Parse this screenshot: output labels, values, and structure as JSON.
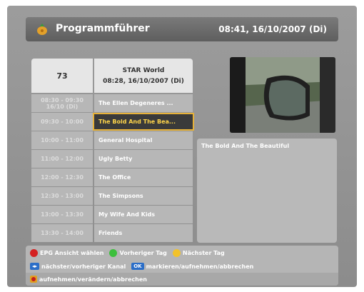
{
  "header": {
    "title": "Programmführer",
    "datetime": "08:41, 16/10/2007 (Di)"
  },
  "channel": {
    "number": "73",
    "name": "STAR World",
    "datetime": "08:28, 16/10/2007 (Di)"
  },
  "schedule": [
    {
      "time": "08:30 - 09:30 16/10 (Di)",
      "program": "The Ellen Degeneres ..."
    },
    {
      "time": "09:30 - 10:00",
      "program": "The Bold And The Bea..."
    },
    {
      "time": "10:00 - 11:00",
      "program": "General Hospital"
    },
    {
      "time": "11:00 - 12:00",
      "program": "Ugly Betty"
    },
    {
      "time": "12:00 - 12:30",
      "program": "The Office"
    },
    {
      "time": "12:30 - 13:00",
      "program": "The Simpsons"
    },
    {
      "time": "13:00 - 13:30",
      "program": "My Wife And Kids"
    },
    {
      "time": "13:30 - 14:00",
      "program": "Friends"
    }
  ],
  "description": {
    "text": "The Bold And The Beautiful"
  },
  "footer": {
    "red_label": "EPG Ansicht wählen",
    "green_label": "Vorheriger Tag",
    "yellow_label": "Nächster Tag",
    "arrows_label": "nächster/vorheriger Kanal",
    "ok_key": "OK",
    "ok_label": "markieren/aufnehmen/abbrechen",
    "record_label": "aufnehmen/verändern/abbrechen"
  },
  "colors": {
    "red": "#d42020",
    "green": "#3cbf3c",
    "yellow": "#f2c22a",
    "highlight_border": "#e7b23a"
  }
}
